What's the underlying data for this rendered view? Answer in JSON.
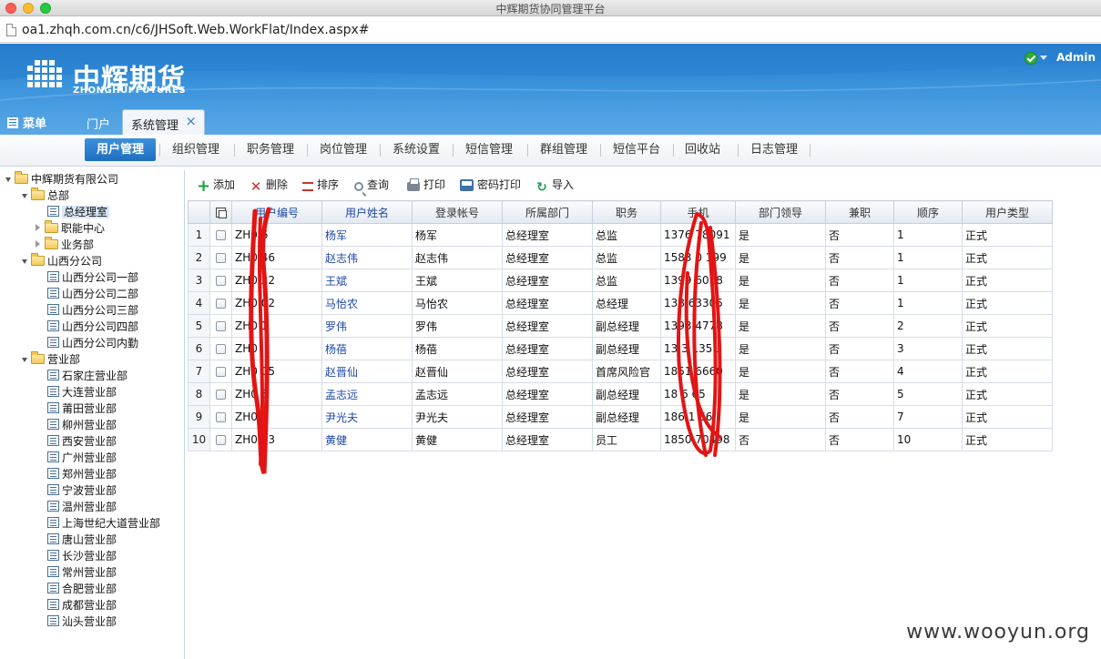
{
  "window": {
    "title": "中辉期货协同管理平台"
  },
  "url": "oa1.zhqh.com.cn/c6/JHSoft.Web.WorkFlat/Index.aspx#",
  "header": {
    "logo_cn": "中辉期货",
    "logo_en": "ZHONGHUI FUTURES",
    "user": "Admin",
    "menu_label": "菜单",
    "tabs": [
      "门户",
      "系统管理"
    ],
    "colors": {
      "header_top": "#1f76c8",
      "header_bottom": "#5aa8e5",
      "active_nav": "#2a7fcc"
    }
  },
  "subnav": {
    "items": [
      "用户管理",
      "组织管理",
      "职务管理",
      "岗位管理",
      "系统设置",
      "短信管理",
      "群组管理",
      "短信平台",
      "回收站",
      "日志管理"
    ],
    "active_index": 0
  },
  "tree": {
    "nodes": [
      {
        "label": "中辉期货有限公司",
        "type": "folder",
        "state": "open"
      },
      {
        "label": "总部",
        "type": "folder",
        "state": "open"
      },
      {
        "label": "总经理室",
        "type": "doc",
        "selected": true
      },
      {
        "label": "职能中心",
        "type": "folder",
        "state": "closed"
      },
      {
        "label": "业务部",
        "type": "folder",
        "state": "closed"
      },
      {
        "label": "山西分公司",
        "type": "folder",
        "state": "open"
      },
      {
        "label": "山西分公司一部",
        "type": "doc"
      },
      {
        "label": "山西分公司二部",
        "type": "doc"
      },
      {
        "label": "山西分公司三部",
        "type": "doc"
      },
      {
        "label": "山西分公司四部",
        "type": "doc"
      },
      {
        "label": "山西分公司内勤",
        "type": "doc"
      },
      {
        "label": "营业部",
        "type": "folder",
        "state": "open"
      },
      {
        "label": "石家庄营业部",
        "type": "doc"
      },
      {
        "label": "大连营业部",
        "type": "doc"
      },
      {
        "label": "莆田营业部",
        "type": "doc"
      },
      {
        "label": "柳州营业部",
        "type": "doc"
      },
      {
        "label": "西安营业部",
        "type": "doc"
      },
      {
        "label": "广州营业部",
        "type": "doc"
      },
      {
        "label": "郑州营业部",
        "type": "doc"
      },
      {
        "label": "宁波营业部",
        "type": "doc"
      },
      {
        "label": "温州营业部",
        "type": "doc"
      },
      {
        "label": "上海世纪大道营业部",
        "type": "doc"
      },
      {
        "label": "唐山营业部",
        "type": "doc"
      },
      {
        "label": "长沙营业部",
        "type": "doc"
      },
      {
        "label": "常州营业部",
        "type": "doc"
      },
      {
        "label": "合肥营业部",
        "type": "doc"
      },
      {
        "label": "成都营业部",
        "type": "doc"
      },
      {
        "label": "汕头营业部",
        "type": "doc"
      }
    ]
  },
  "toolbar": {
    "buttons": [
      {
        "label": "添加",
        "icon": "plus-icon"
      },
      {
        "label": "删除",
        "icon": "delete-icon"
      },
      {
        "label": "排序",
        "icon": "sort-icon"
      },
      {
        "label": "查询",
        "icon": "search-icon"
      },
      {
        "label": "打印",
        "icon": "print-icon"
      },
      {
        "label": "密码打印",
        "icon": "password-print-icon"
      },
      {
        "label": "导入",
        "icon": "import-icon"
      }
    ]
  },
  "table": {
    "columns": [
      "用户编号",
      "用户姓名",
      "登录帐号",
      "所属部门",
      "职务",
      "手机",
      "部门领导",
      "兼职",
      "顺序",
      "用户类型"
    ],
    "rows": [
      [
        "1",
        "ZH0  6",
        "杨军",
        "杨军",
        "总经理室",
        "总监",
        "1376   78091",
        "是",
        "否",
        "1",
        "正式"
      ],
      [
        "2",
        "ZH0  46",
        "赵志伟",
        "赵志伟",
        "总经理室",
        "总监",
        "1583   0 199",
        "是",
        "否",
        "1",
        "正式"
      ],
      [
        "3",
        "ZH0 22",
        "王斌",
        "王斌",
        "总经理室",
        "总监",
        "1399   6018",
        "是",
        "否",
        "1",
        "正式"
      ],
      [
        "4",
        "ZH0 02",
        "马怡农",
        "马怡农",
        "总经理室",
        "总经理",
        "138   63305",
        "是",
        "否",
        "1",
        "正式"
      ],
      [
        "5",
        "ZH0  1",
        "罗伟",
        "罗伟",
        "总经理室",
        "副总经理",
        "1393   4778",
        "是",
        "否",
        "2",
        "正式"
      ],
      [
        "6",
        "ZH0",
        "杨蓓",
        "杨蓓",
        "总经理室",
        "副总经理",
        "13   3 1351",
        "是",
        "否",
        "3",
        "正式"
      ],
      [
        "7",
        "ZH0  05",
        "赵晋仙",
        "赵晋仙",
        "总经理室",
        "首席风险官",
        "1851   6660",
        "是",
        "否",
        "4",
        "正式"
      ],
      [
        "8",
        "ZH0  5",
        "孟志远",
        "孟志远",
        "总经理室",
        "副总经理",
        "18 6   65",
        "是",
        "否",
        "5",
        "正式"
      ],
      [
        "9",
        "ZH0  0",
        "尹光夫",
        "尹光夫",
        "总经理室",
        "副总经理",
        "186   1 66",
        "是",
        "否",
        "7",
        "正式"
      ],
      [
        "10",
        "ZH04  3",
        "黄健",
        "黄健",
        "总经理室",
        "员工",
        "1850   70498",
        "否",
        "否",
        "10",
        "正式"
      ]
    ]
  },
  "watermark": "www.wooyun.org"
}
